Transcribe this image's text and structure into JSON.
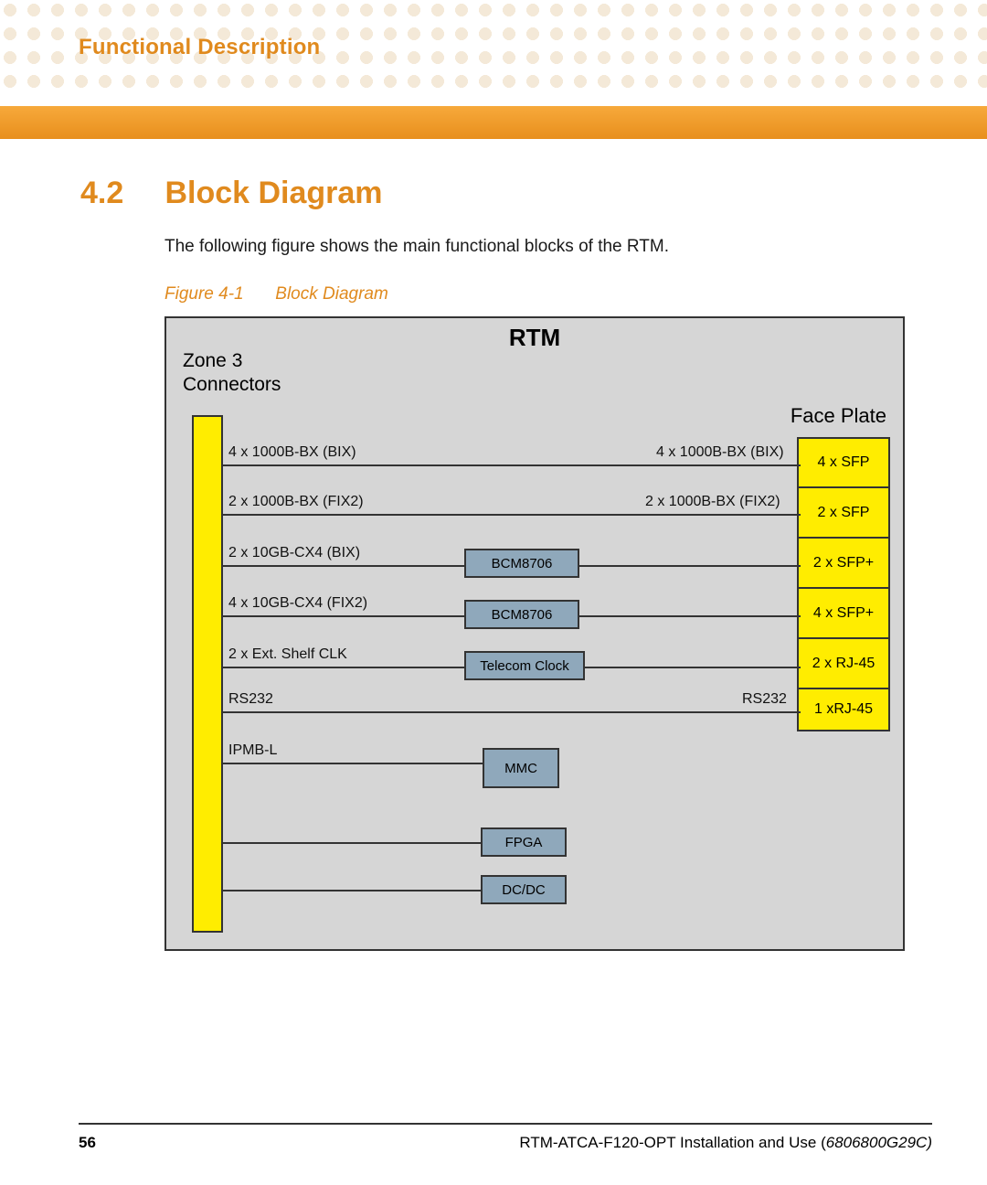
{
  "header": {
    "running_title": "Functional Description"
  },
  "section": {
    "number": "4.2",
    "title": "Block Diagram",
    "intro": "The following figure shows the main functional blocks of the RTM."
  },
  "figure": {
    "caption_num": "Figure 4-1",
    "caption_title": "Block Diagram",
    "main_title": "RTM",
    "zone_label": "Zone 3\nConnectors",
    "faceplate_label": "Face Plate"
  },
  "faceplate": [
    "4 x SFP",
    "2 x SFP",
    "2 x SFP+",
    "4 x SFP+",
    "2 x RJ-45",
    "1 xRJ-45"
  ],
  "signals": {
    "r1_left": "4 x 1000B-BX (BIX)",
    "r1_right": "4 x 1000B-BX (BIX)",
    "r2_left": "2 x 1000B-BX (FIX2)",
    "r2_right": "2 x 1000B-BX (FIX2)",
    "r3_left": "2 x 10GB-CX4 (BIX)",
    "r4_left": "4 x 10GB-CX4 (FIX2)",
    "r5_left": "2 x Ext. Shelf CLK",
    "r6_left": "RS232",
    "r6_right": "RS232",
    "r7_left": "IPMB-L"
  },
  "chips": {
    "bcm1": "BCM8706",
    "bcm2": "BCM8706",
    "tclk": "Telecom Clock",
    "mmc": "MMC",
    "fpga": "FPGA",
    "dcdc": "DC/DC"
  },
  "footer": {
    "page": "56",
    "doc": "RTM-ATCA-F120-OPT Installation and Use (",
    "partno": "6806800G29C)"
  }
}
